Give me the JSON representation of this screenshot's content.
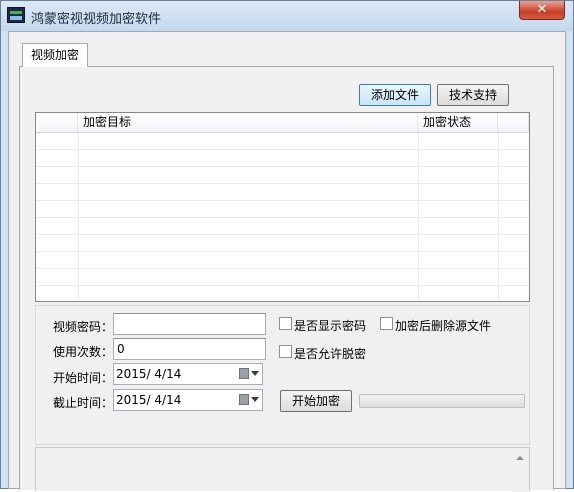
{
  "window": {
    "title": "鸿蒙密视视频加密软件",
    "close_label": "✕"
  },
  "tab": {
    "label": "视频加密"
  },
  "toolbar": {
    "add_file_label": "添加文件",
    "support_label": "技术支持"
  },
  "file_list": {
    "columns": [
      "加密目标",
      "加密状态"
    ],
    "rows": []
  },
  "form": {
    "password_label": "视频密码：",
    "password_value": "",
    "uses_label": "使用次数：",
    "uses_value": "0",
    "start_label": "开始时间：",
    "start_value": "2015/  4/14",
    "end_label": "截止时间：",
    "end_value": "2015/  4/14",
    "show_password_label": "是否显示密码",
    "show_password_checked": false,
    "delete_source_label": "加密后删除源文件",
    "delete_source_checked": false,
    "allow_decrypt_label": "是否允许脱密",
    "allow_decrypt_checked": false,
    "start_button_label": "开始加密",
    "progress": 0
  },
  "log": {
    "text": ""
  },
  "icons": {
    "app": "app-icon",
    "calendar": "calendar-icon",
    "dropdown": "chevron-down-icon",
    "scroll_up": "chevron-up-icon"
  }
}
